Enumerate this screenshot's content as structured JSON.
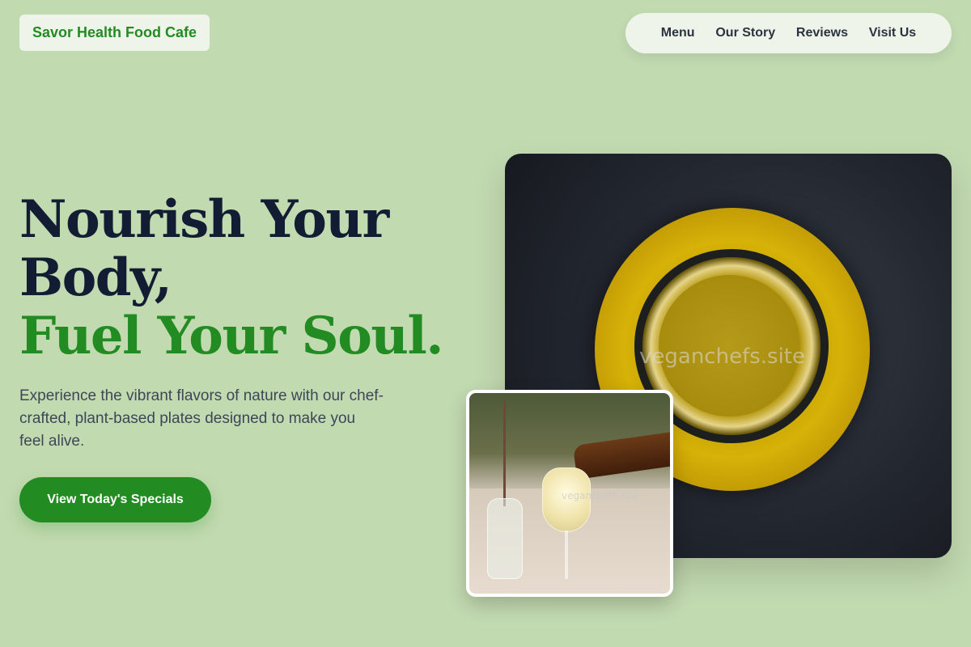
{
  "brand": {
    "name": "Savor Health Food Cafe",
    "accent": "#228b22"
  },
  "nav": {
    "items": [
      "Menu",
      "Our Story",
      "Reviews",
      "Visit Us"
    ]
  },
  "hero": {
    "headline_line1": "Nourish Your",
    "headline_line2": "Body,",
    "headline_line3": "Fuel Your Soul.",
    "lede": "Experience the vibrant flavors of nature with our chef-crafted, plant-based plates designed to make you feel alive.",
    "cta": "View Today's Specials"
  },
  "images": {
    "main_watermark": "veganchefs.site",
    "inset_watermark": "veganchefs.site"
  }
}
